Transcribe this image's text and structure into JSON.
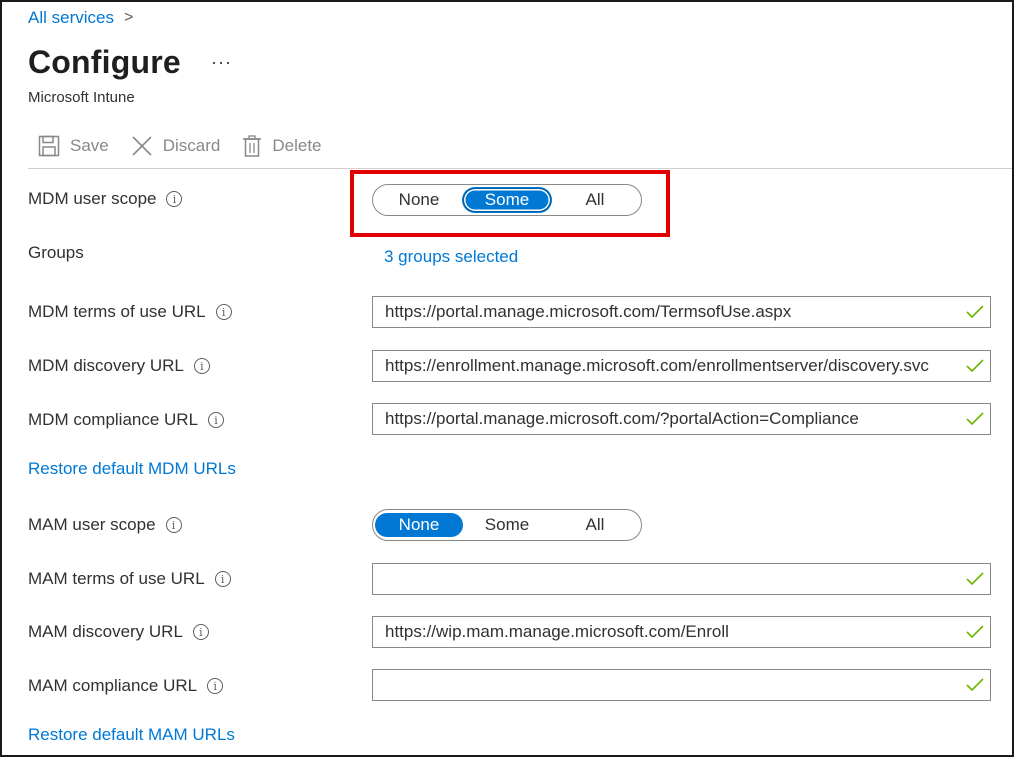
{
  "breadcrumb": {
    "root": "All services",
    "separator": ">"
  },
  "header": {
    "title": "Configure",
    "more": "···",
    "subtitle": "Microsoft Intune"
  },
  "toolbar": {
    "save": "Save",
    "discard": "Discard",
    "delete": "Delete"
  },
  "mdm": {
    "scope_label": "MDM user scope",
    "scope_options": [
      "None",
      "Some",
      "All"
    ],
    "scope_selected": "Some",
    "groups_label": "Groups",
    "groups_link": "3 groups selected",
    "terms_label": "MDM terms of use URL",
    "terms_value": "https://portal.manage.microsoft.com/TermsofUse.aspx",
    "discovery_label": "MDM discovery URL",
    "discovery_value": "https://enrollment.manage.microsoft.com/enrollmentserver/discovery.svc",
    "compliance_label": "MDM compliance URL",
    "compliance_value": "https://portal.manage.microsoft.com/?portalAction=Compliance",
    "restore": "Restore default MDM URLs"
  },
  "mam": {
    "scope_label": "MAM user scope",
    "scope_options": [
      "None",
      "Some",
      "All"
    ],
    "scope_selected": "None",
    "terms_label": "MAM terms of use URL",
    "terms_value": "",
    "discovery_label": "MAM discovery URL",
    "discovery_value": "https://wip.mam.manage.microsoft.com/Enroll",
    "compliance_label": "MAM compliance URL",
    "compliance_value": "",
    "restore": "Restore default MAM URLs"
  },
  "info_glyph": "i",
  "colors": {
    "accent": "#0078d4",
    "highlight": "#e00000",
    "check": "#6bb700"
  },
  "icons": {
    "save": "save-icon",
    "discard": "discard-icon",
    "delete": "delete-icon",
    "check": "checkmark-icon",
    "info": "info-icon"
  }
}
